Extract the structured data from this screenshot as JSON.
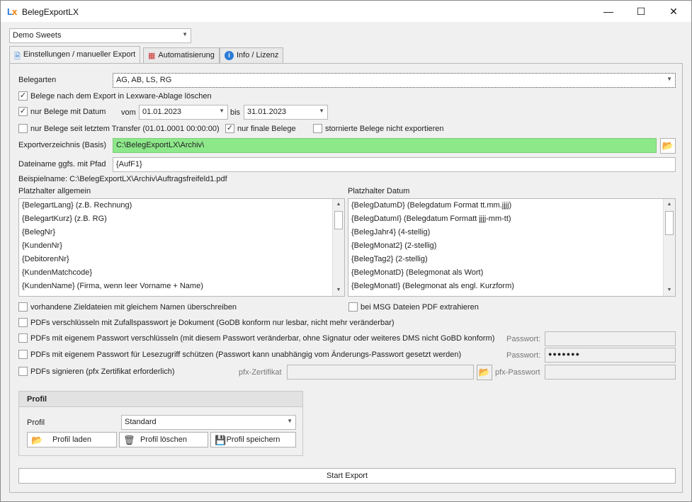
{
  "window": {
    "title": "BelegExportLX",
    "logo_l": "L",
    "logo_x": "x",
    "minimize": "—",
    "maximize": "☐",
    "close": "✕"
  },
  "company_select": {
    "value": "Demo Sweets"
  },
  "tabs": [
    {
      "label": "Einstellungen / manueller Export",
      "icon": "document-settings-icon"
    },
    {
      "label": "Automatisierung",
      "icon": "calendar-clock-icon"
    },
    {
      "label": "Info / Lizenz",
      "icon": "info-icon"
    }
  ],
  "belegarten": {
    "label": "Belegarten",
    "value": "AG, AB, LS, RG"
  },
  "options": {
    "delete_after_export": "Belege nach dem Export in Lexware-Ablage löschen",
    "only_with_date": "nur Belege mit Datum",
    "since_last_transfer": "nur Belege seit letztem Transfer (01.01.0001 00:00:00)",
    "only_final": "nur finale Belege",
    "no_cancelled": "stornierte Belege nicht exportieren"
  },
  "date_range": {
    "from_label": "vom",
    "from": "01.01.2023",
    "to_label": "bis",
    "to": "31.01.2023"
  },
  "export_dir": {
    "label": "Exportverzeichnis (Basis)",
    "value": "C:\\BelegExportLX\\Archiv\\"
  },
  "filename": {
    "label": "Dateiname ggfs. mit Pfad",
    "value": "{AufF1}"
  },
  "example": "Beispielname: C:\\BelegExportLX\\Archiv\\Auftragsfreifeld1.pdf",
  "placeholder_general": {
    "label": "Platzhalter allgemein",
    "items": [
      "{BelegartLang} (z.B. Rechnung)",
      "{BelegartKurz} (z.B. RG)",
      "{BelegNr}",
      "{KundenNr}",
      "{DebitorenNr}",
      "{KundenMatchcode}",
      "{KundenName} (Firma, wenn leer Vorname + Name)"
    ]
  },
  "placeholder_date": {
    "label": "Platzhalter Datum",
    "items": [
      "{BelegDatumD} (Belegdatum Format tt.mm.jjjj)",
      "{BelegDatumI} (Belegdatum Formatt jjjj-mm-tt)",
      "{BelegJahr4} (4-stellig)",
      "{BelegMonat2} (2-stellig)",
      "{BelegTag2} (2-stellig)",
      "{BelegMonatD} (Belegmonat als Wort)",
      "{BelegMonatI} (Belegmonat als engl. Kurzform)"
    ]
  },
  "pdf_options": {
    "overwrite": "vorhandene Zieldateien mit gleichem Namen überschreiben",
    "msg_extract": "bei MSG Dateien PDF extrahieren",
    "random_pw": "PDFs verschlüsseln mit Zufallspasswort je Dokument (GoDB konform nur lesbar, nicht mehr veränderbar)",
    "own_pw": "PDFs mit eigenem Passwort verschlüsseln (mit diesem Passwort veränderbar, ohne Signatur oder weiteres DMS nicht GoBD konform)",
    "read_pw": "PDFs mit eigenem Passwort für Lesezugriff schützen (Passwort kann unabhängig vom Änderungs-Passwort gesetzt werden)",
    "sign": "PDFs signieren (pfx Zertifikat erforderlich)",
    "password_label_1": "Passwort:",
    "password_label_2": "Passwort:",
    "password_value_2": "●●●●●●●",
    "pfx_cert_label": "pfx-Zertifikat",
    "pfx_pw_label": "pfx-Passwort"
  },
  "profile": {
    "header": "Profil",
    "label": "Profil",
    "value": "Standard",
    "load": "Profil laden",
    "delete": "Profil löschen",
    "save": "Profil speichern"
  },
  "start_export": "Start Export"
}
